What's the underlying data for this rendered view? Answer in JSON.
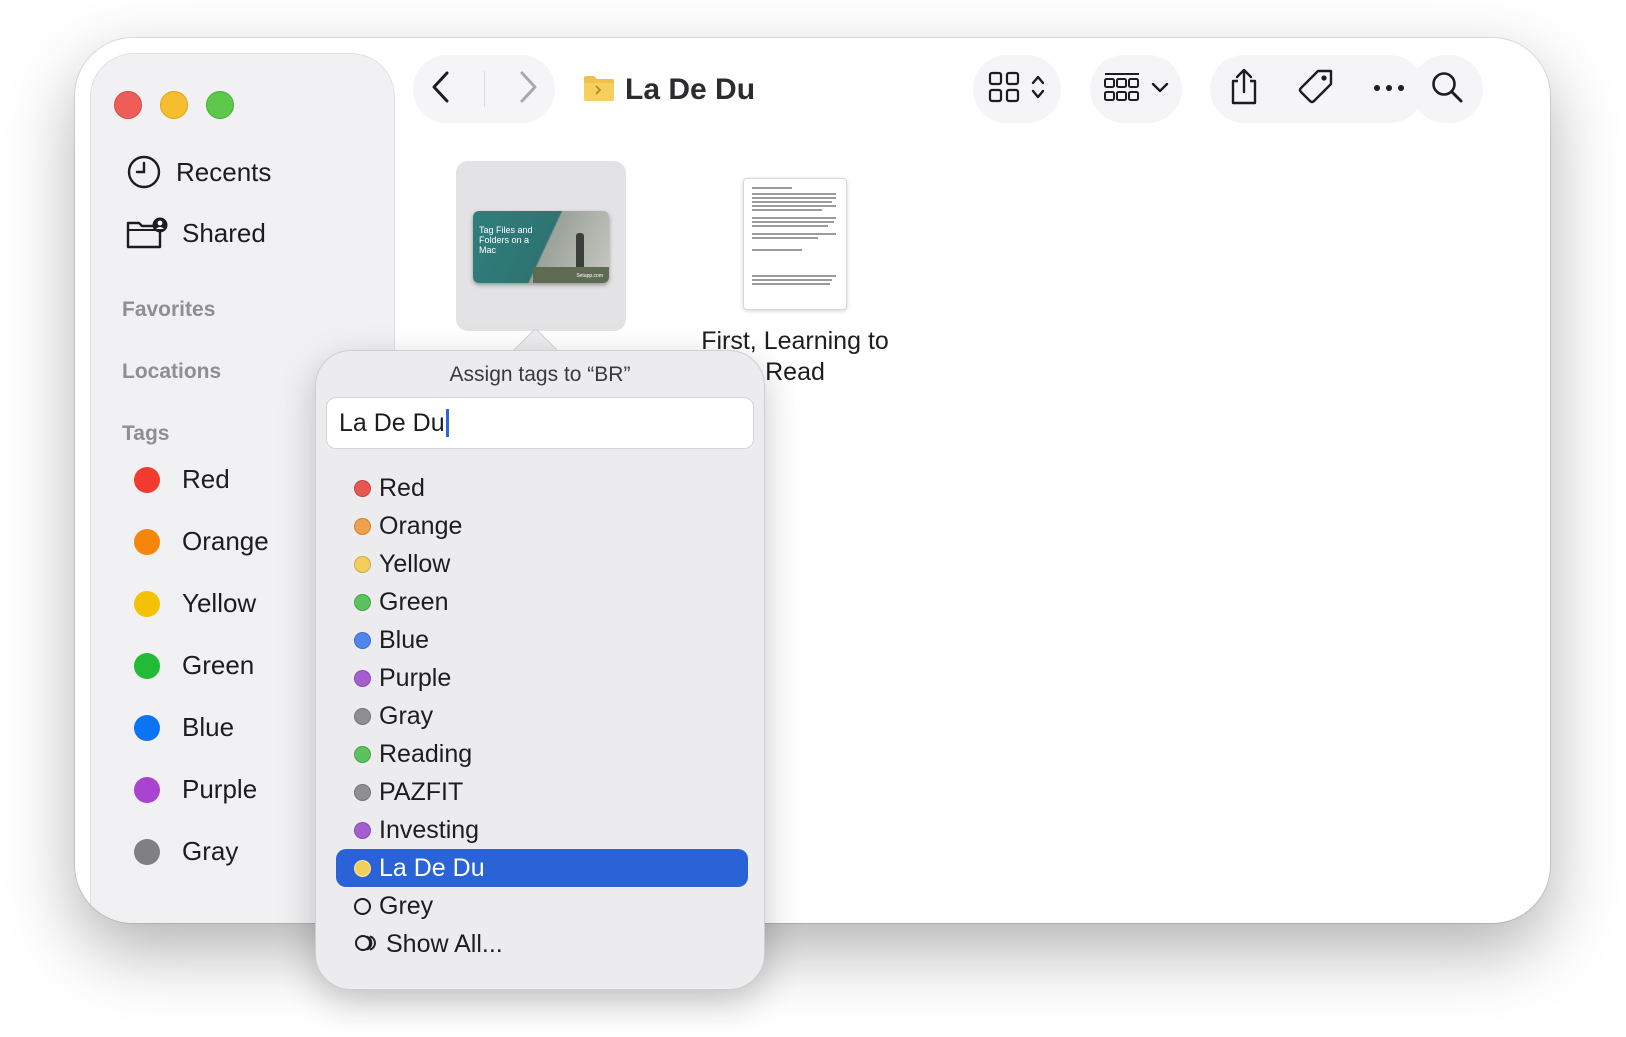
{
  "window": {
    "title": "La De Du"
  },
  "sidebar": {
    "items": [
      {
        "label": "Recents",
        "icon": "clock-icon"
      },
      {
        "label": "Shared",
        "icon": "shared-folder-icon"
      }
    ],
    "sections": {
      "favorites": "Favorites",
      "locations": "Locations",
      "tags": "Tags"
    },
    "tags": [
      {
        "label": "Red",
        "color": "#f23a2f"
      },
      {
        "label": "Orange",
        "color": "#f6850a"
      },
      {
        "label": "Yellow",
        "color": "#f5c104"
      },
      {
        "label": "Green",
        "color": "#22bb35"
      },
      {
        "label": "Blue",
        "color": "#0a74f5"
      },
      {
        "label": "Purple",
        "color": "#a844d0"
      },
      {
        "label": "Gray",
        "color": "#808084"
      }
    ]
  },
  "toolbar": {
    "back_icon": "chevron-left-icon",
    "forward_icon": "chevron-right-icon",
    "view_icon": "grid-view-icon",
    "group_icon": "group-icon",
    "share_icon": "share-icon",
    "tag_icon": "tag-icon",
    "more_icon": "ellipsis-icon",
    "search_icon": "search-icon"
  },
  "files": [
    {
      "thumb_text": "Tag Files and Folders on a Mac",
      "watermark": "Setapp.com"
    },
    {
      "label_line1": "First, Learning to",
      "label_line2": "Read"
    }
  ],
  "popover": {
    "title": "Assign tags to “BR”",
    "input_value": "La De Du",
    "options": [
      {
        "label": "Red",
        "color": "#e8574f"
      },
      {
        "label": "Orange",
        "color": "#f0a04b"
      },
      {
        "label": "Yellow",
        "color": "#f3cf5a"
      },
      {
        "label": "Green",
        "color": "#5cc25e"
      },
      {
        "label": "Blue",
        "color": "#4f86ee"
      },
      {
        "label": "Purple",
        "color": "#a45ed0"
      },
      {
        "label": "Gray",
        "color": "#8e8e93"
      },
      {
        "label": "Reading",
        "color": "#5cc25e"
      },
      {
        "label": "PAZFIT",
        "color": "#8e8e93"
      },
      {
        "label": "Investing",
        "color": "#a45ed0"
      },
      {
        "label": "La De Du",
        "color": "#f3cf5a",
        "selected": true
      },
      {
        "label": "Grey",
        "color": "none"
      },
      {
        "label": "Show All...",
        "color": "none"
      }
    ]
  }
}
